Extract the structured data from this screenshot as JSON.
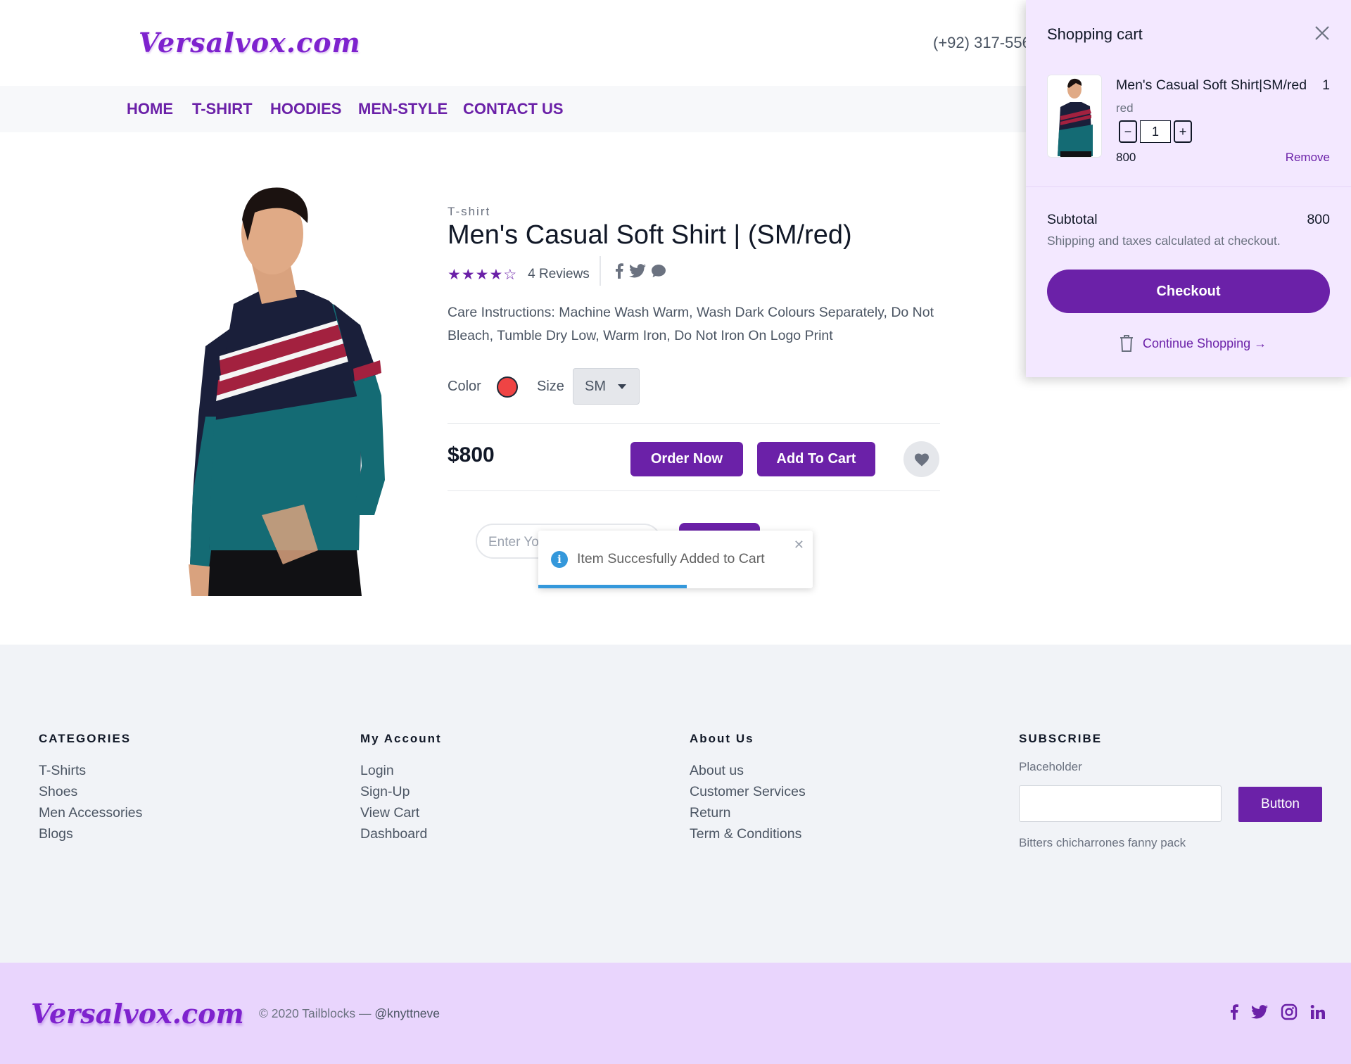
{
  "header": {
    "logo": "Versalvox.com",
    "phone": "(+92) 317-556"
  },
  "nav": {
    "items": [
      "HOME",
      "T-SHIRT",
      "HOODIES",
      "MEN-STYLE",
      "CONTACT US"
    ]
  },
  "product": {
    "category": "T-shirt",
    "title": "Men's Casual Soft Shirt | (SM/red)",
    "rating": 4,
    "rating_max": 5,
    "reviews": "4 Reviews",
    "description": "Care Instructions: Machine Wash Warm, Wash Dark Colours Separately, Do Not Bleach, Tumble Dry Low, Warm Iron, Do Not Iron On Logo Print",
    "color_label": "Color",
    "color_value": "#ef4444",
    "size_label": "Size",
    "size_value": "SM",
    "price": "$800",
    "order_now": "Order Now",
    "add_to_cart": "Add To Cart",
    "pincode_placeholder": "Enter Yo"
  },
  "toast": {
    "message": "Item Succesfully Added to Cart",
    "progress": 0.54
  },
  "cart": {
    "title": "Shopping cart",
    "item": {
      "name": "Men's Casual Soft Shirt|SM/red",
      "qty_display": "1",
      "variant": "red",
      "qty": "1",
      "price": "800",
      "remove": "Remove"
    },
    "subtotal_label": "Subtotal",
    "subtotal_value": "800",
    "shipping_note": "Shipping and taxes calculated at checkout.",
    "checkout": "Checkout",
    "continue": "Continue Shopping →"
  },
  "footer": {
    "columns": [
      {
        "heading": "CATEGORIES",
        "links": [
          "T-Shirts",
          "Shoes",
          "Men Accessories",
          "Blogs"
        ]
      },
      {
        "heading": "My Account",
        "links": [
          "Login",
          "Sign-Up",
          "View Cart",
          "Dashboard"
        ]
      },
      {
        "heading": "About Us",
        "links": [
          "About us",
          "Customer Services",
          "Return",
          "Term & Conditions"
        ]
      }
    ],
    "subscribe": {
      "heading": "SUBSCRIBE",
      "label": "Placeholder",
      "button": "Button",
      "note": "Bitters chicharrones fanny pack"
    },
    "logo": "Versalvox.com",
    "copyright": "© 2020 Tailblocks —",
    "handle": "@knyttneve"
  },
  "colors": {
    "brand": "#6b21a8",
    "cart_bg": "#f3e8ff",
    "bottom_bar_bg": "#e9d5fd",
    "toast_accent": "#3498db"
  }
}
